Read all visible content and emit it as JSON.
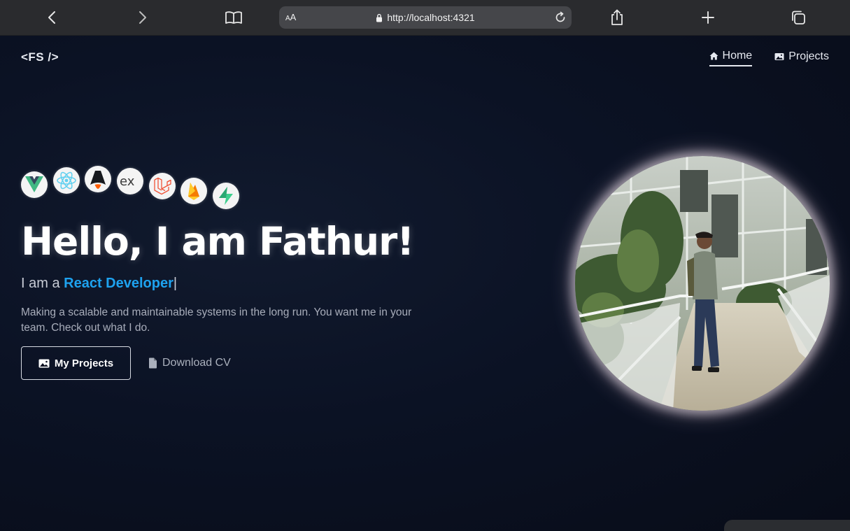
{
  "browser": {
    "url": "http://localhost:4321",
    "reader_label_big": "A",
    "reader_label_small": "A"
  },
  "site": {
    "logo": "<FS />",
    "nav": [
      {
        "label": "Home",
        "icon": "home-icon",
        "active": true
      },
      {
        "label": "Projects",
        "icon": "image-icon",
        "active": false
      }
    ]
  },
  "hero": {
    "tech_icons": [
      "vue-icon",
      "react-icon",
      "astro-icon",
      "express-icon",
      "laravel-icon",
      "firebase-icon",
      "supabase-icon"
    ],
    "headline": "Hello, I am Fathur!",
    "intro_prefix": "I am a",
    "role": "React Developer",
    "cursor": "|",
    "description": "Making a scalable and maintainable systems in the long run. You want me in your team. Check out what I do.",
    "primary_button": "My Projects",
    "secondary_button": "Download CV"
  },
  "colors": {
    "background": "#0b1020",
    "accent": "#1ea2ef",
    "browser_chrome": "#2a2b2e"
  }
}
